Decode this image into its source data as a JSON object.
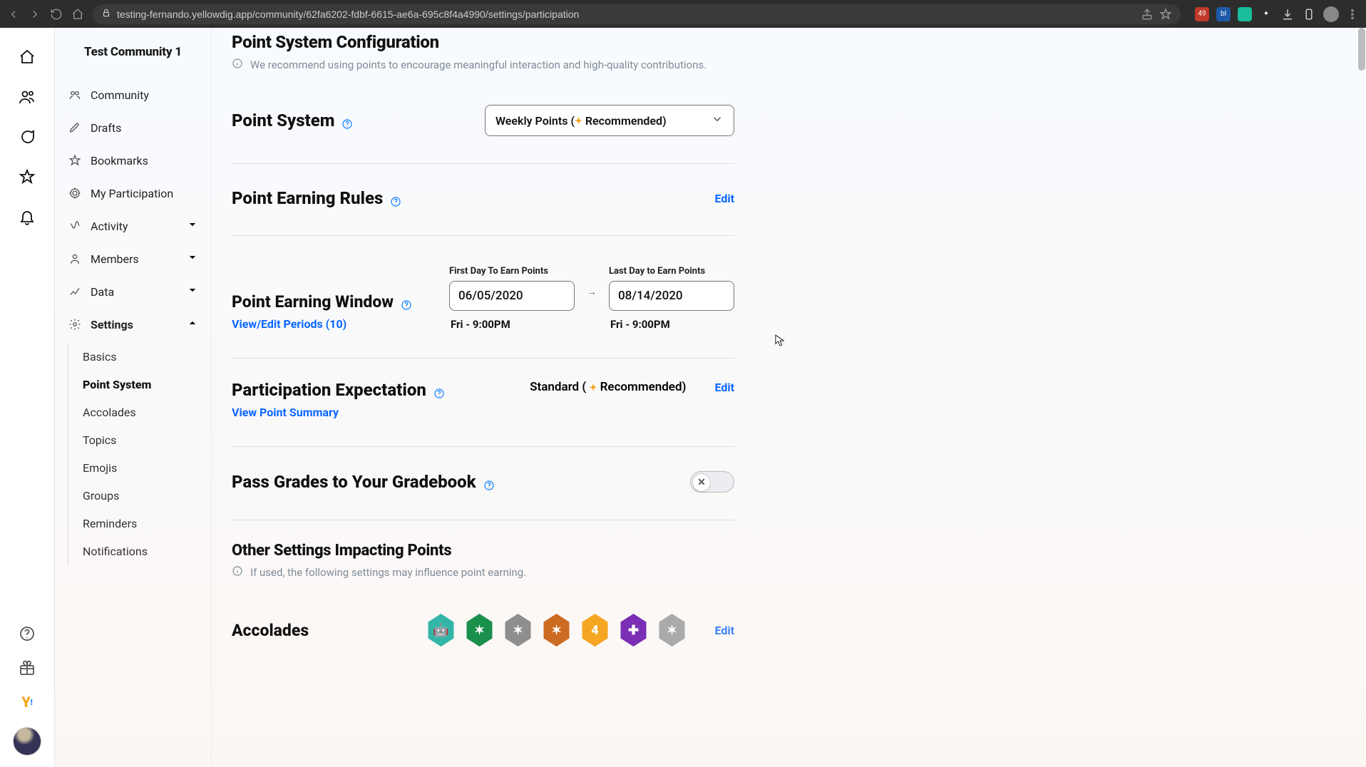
{
  "browser": {
    "url": "testing-fernando.yellowdig.app/community/62fa6202-fdbf-6615-ae6a-695c8f4a4990/settings/participation",
    "ext_ub_badge": "49"
  },
  "rail": {},
  "sidebar": {
    "community_title": "Test Community 1",
    "items": [
      {
        "label": "Community"
      },
      {
        "label": "Drafts"
      },
      {
        "label": "Bookmarks"
      },
      {
        "label": "My Participation"
      },
      {
        "label": "Activity"
      },
      {
        "label": "Members"
      },
      {
        "label": "Data"
      },
      {
        "label": "Settings"
      }
    ],
    "settings_sub": [
      {
        "label": "Basics"
      },
      {
        "label": "Point System"
      },
      {
        "label": "Accolades"
      },
      {
        "label": "Topics"
      },
      {
        "label": "Emojis"
      },
      {
        "label": "Groups"
      },
      {
        "label": "Reminders"
      },
      {
        "label": "Notifications"
      }
    ]
  },
  "main": {
    "config_title": "Point System Configuration",
    "config_hint": "We recommend using points to encourage meaningful interaction and high-quality contributions.",
    "point_system_label": "Point System",
    "point_system_value_pre": "Weekly Points (",
    "point_system_value_post": " Recommended)",
    "rules_label": "Point Earning Rules",
    "edit_label": "Edit",
    "window_label": "Point Earning Window",
    "periods_link": "View/Edit Periods (10)",
    "first_day_label": "First Day To Earn Points",
    "last_day_label": "Last Day to Earn Points",
    "first_day_value": "06/05/2020",
    "last_day_value": "08/14/2020",
    "first_day_sub": "Fri - 9:00PM",
    "last_day_sub": "Fri - 9:00PM",
    "pe_label": "Participation Expectation",
    "pe_link": "View Point Summary",
    "pe_value_pre": "Standard ( ",
    "pe_value_post": " Recommended)",
    "pass_label": "Pass Grades to Your Gradebook",
    "other_title": "Other Settings Impacting Points",
    "other_hint": "If used, the following settings may influence point earning.",
    "accolades_label": "Accolades"
  }
}
